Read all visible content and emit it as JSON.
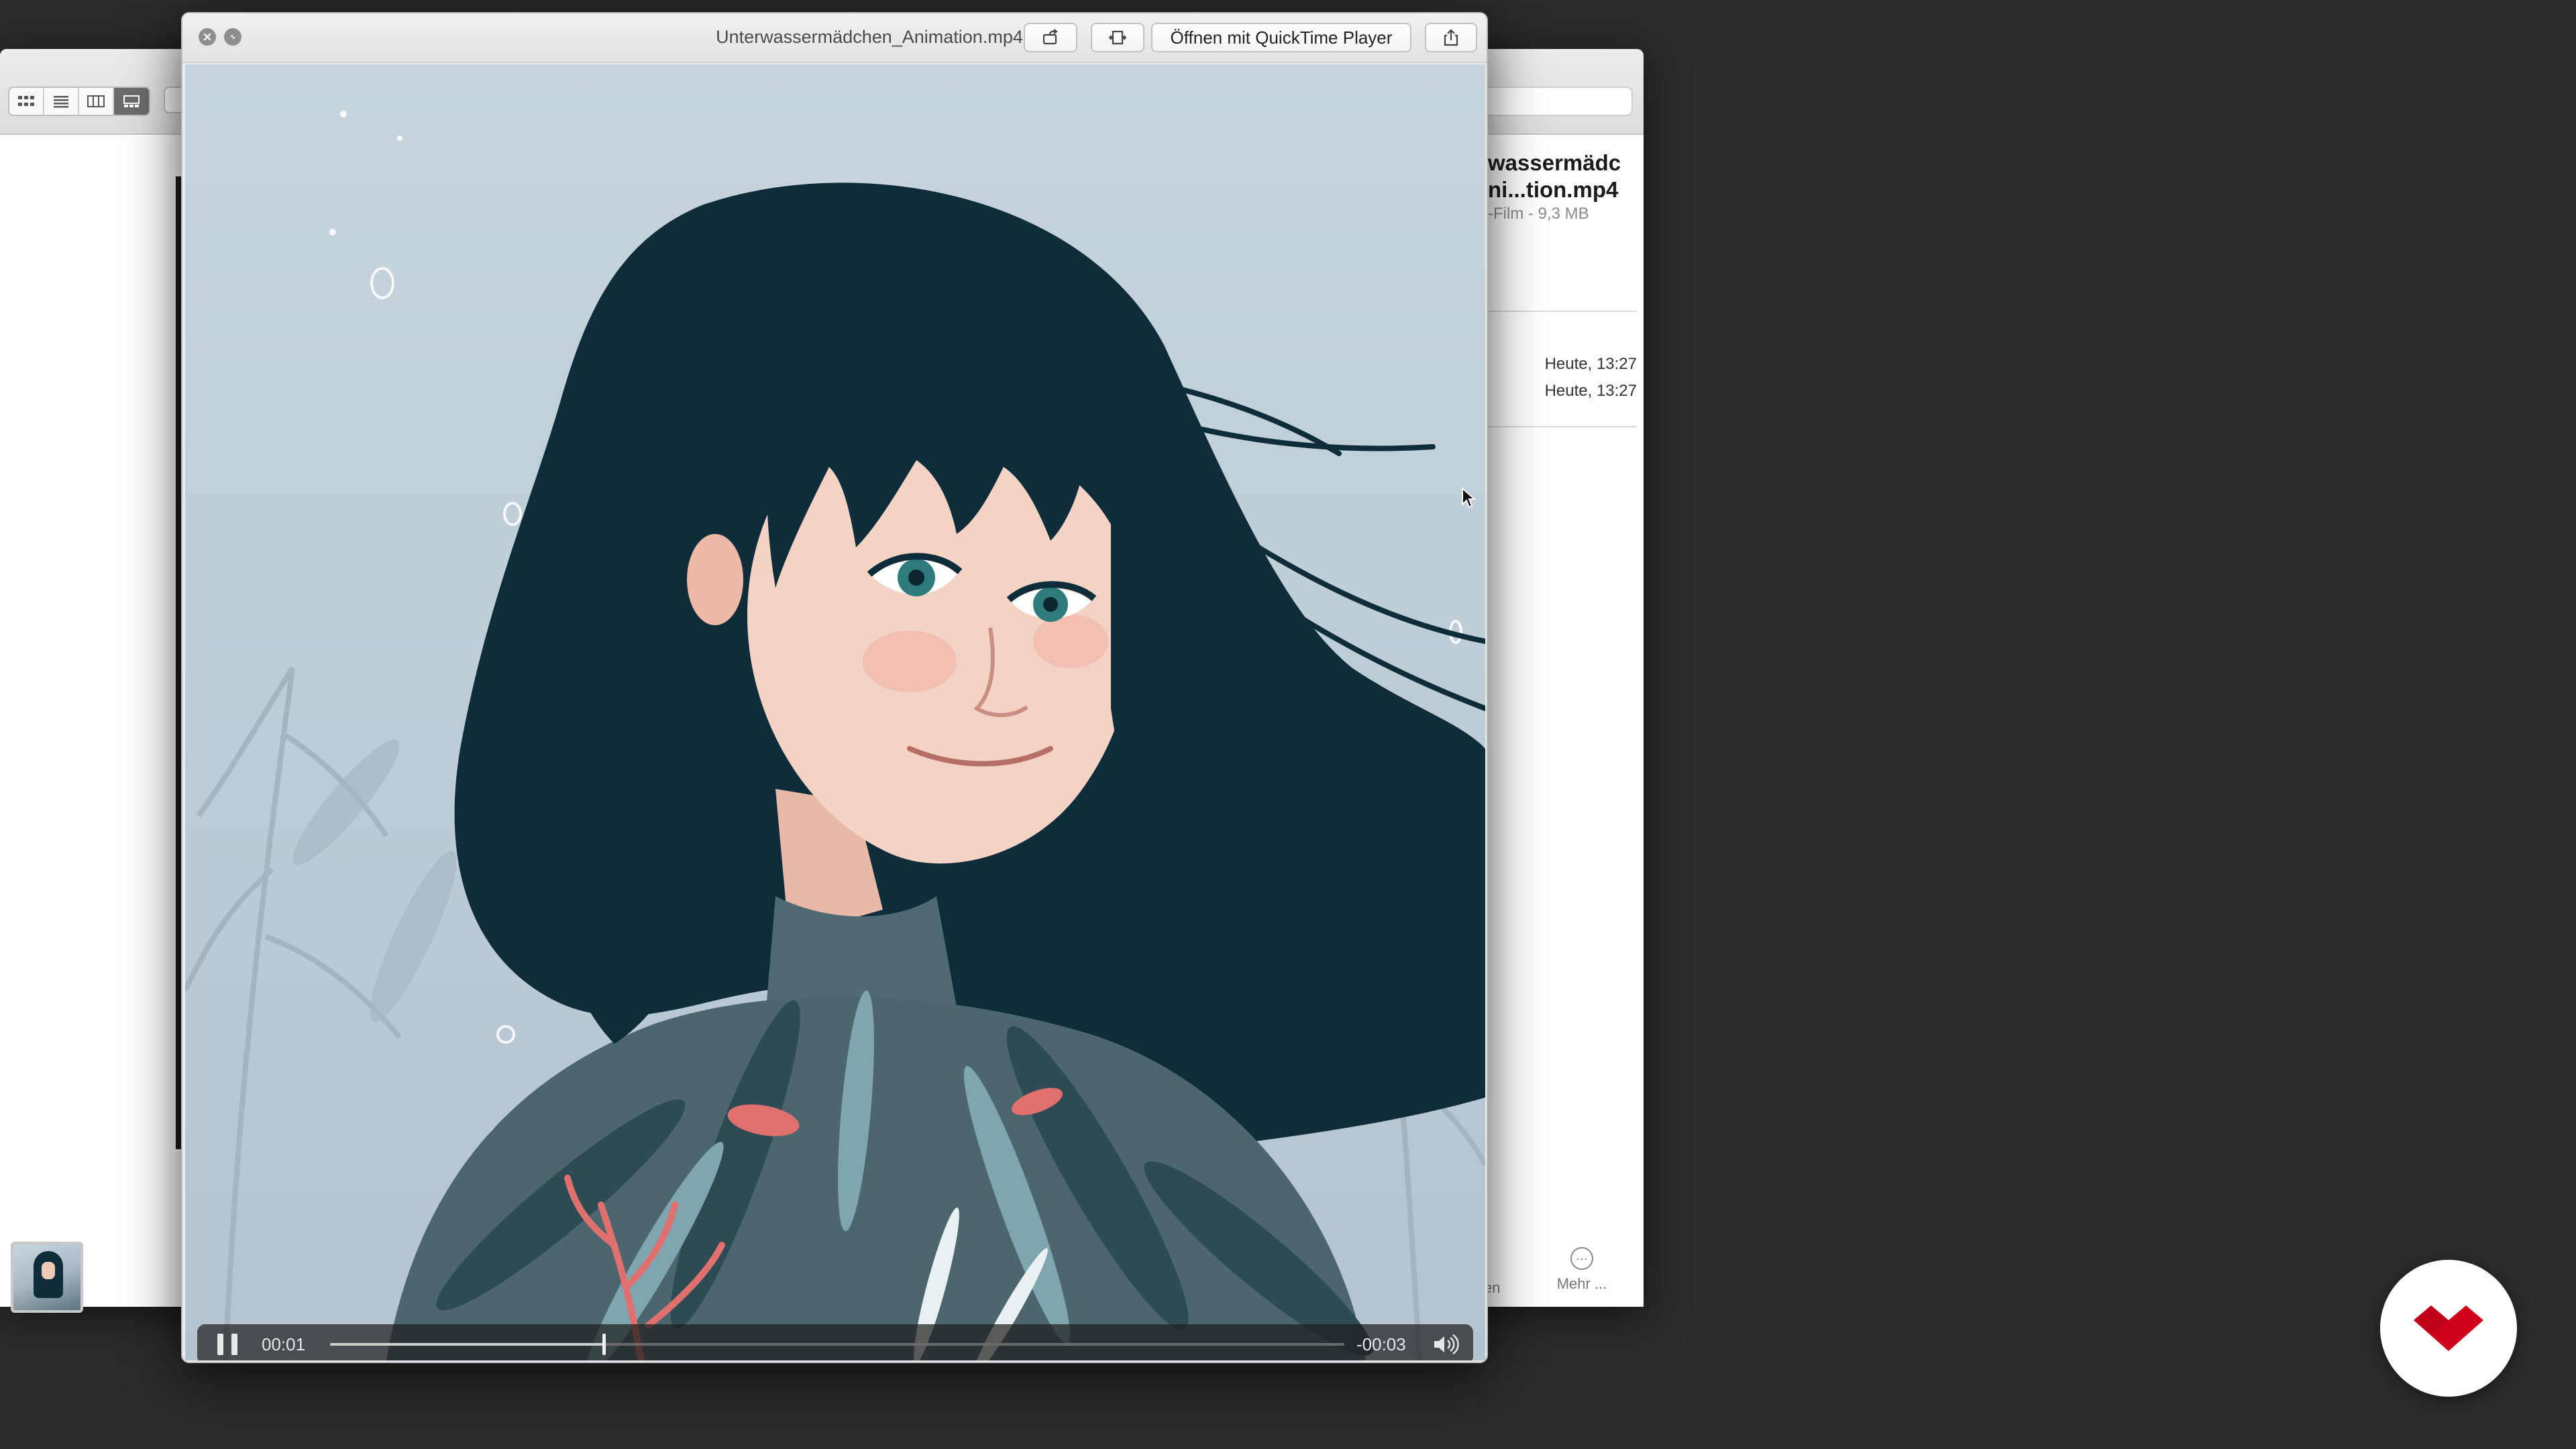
{
  "finder": {
    "view_modes": [
      "icon-view",
      "list-view",
      "column-view",
      "gallery-view"
    ],
    "active_view": "gallery-view",
    "info": {
      "title_line1": "wassermädc",
      "title_line2": "ni...tion.mp4",
      "subtitle": "-Film - 9,3 MB",
      "created": "Heute, 13:27",
      "modified": "Heute, 13:27"
    },
    "more_label": "Mehr ...",
    "partial_action_label": "en"
  },
  "quicklook": {
    "title": "Unterwassermädchen_Animation.mp4",
    "open_with_label": "Öffnen mit QuickTime Player",
    "player": {
      "current_time": "00:01",
      "remaining_time": "-00:03",
      "progress": 0.27,
      "state": "playing"
    }
  },
  "colors": {
    "video_background": "#bccbd6",
    "hair": "#0f2c3b",
    "skin": "#f3d3c4",
    "brand_accent": "#d0021b"
  }
}
